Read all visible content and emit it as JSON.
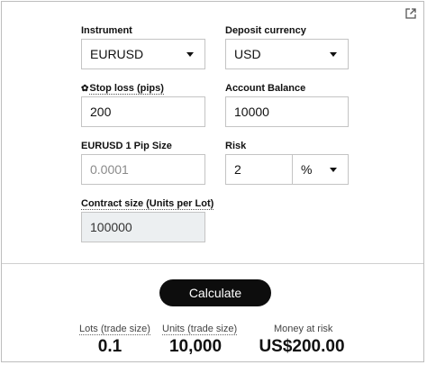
{
  "form": {
    "instrument": {
      "label": "Instrument",
      "value": "EURUSD"
    },
    "deposit_currency": {
      "label": "Deposit currency",
      "value": "USD"
    },
    "stop_loss": {
      "label": "Stop loss (pips)",
      "value": "200"
    },
    "account_balance": {
      "label": "Account Balance",
      "value": "10000"
    },
    "pip_size": {
      "label": "EURUSD 1 Pip Size",
      "value": "0.0001"
    },
    "risk": {
      "label": "Risk",
      "value": "2",
      "unit": "%"
    },
    "contract_size": {
      "label": "Contract size (Units per Lot)",
      "value": "100000"
    }
  },
  "actions": {
    "calculate_label": "Calculate"
  },
  "results": {
    "lots": {
      "label": "Lots (trade size)",
      "value": "0.1"
    },
    "units": {
      "label": "Units (trade size)",
      "value": "10,000"
    },
    "money": {
      "label": "Money at risk",
      "value": "US$200.00"
    }
  }
}
